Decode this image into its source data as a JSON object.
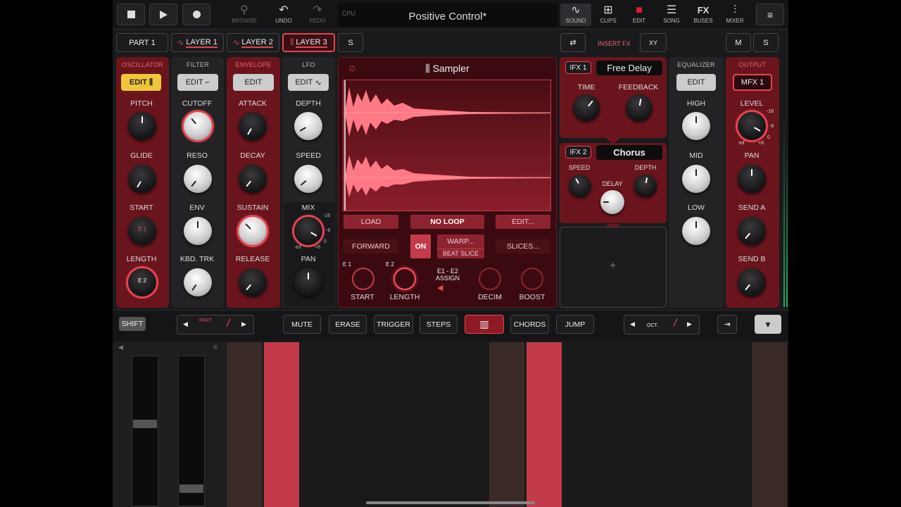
{
  "toolbar": {
    "browse": "BROWSE",
    "undo": "UNDO",
    "redo": "REDO",
    "cpu": "CPU",
    "title": "Positive Control*",
    "sound": "SOUND",
    "clips": "CLIPS",
    "edit": "EDIT",
    "song": "SONG",
    "fx": "FX",
    "buses": "BUSES",
    "mixer": "MIXER"
  },
  "parts": {
    "part": "PART",
    "part_num": "1",
    "layer1": "LAYER 1",
    "layer2": "LAYER 2",
    "layer3": "LAYER 3",
    "s": "S",
    "insert_fx": "INSERT FX",
    "xy": "XY",
    "m": "M",
    "s2": "S"
  },
  "osc": {
    "h": "OSCILLATOR",
    "edit": "EDIT",
    "pitch": "PITCH",
    "glide": "GLIDE",
    "start": "START",
    "length": "LENGTH",
    "e1": "E 1",
    "e2": "E 2"
  },
  "filter": {
    "h": "FILTER",
    "edit": "EDIT",
    "cutoff": "CUTOFF",
    "reso": "RESO",
    "env": "ENV",
    "kbd": "KBD. TRK"
  },
  "envelope": {
    "h": "ENVELOPE",
    "edit": "EDIT",
    "attack": "ATTACK",
    "decay": "DECAY",
    "sustain": "SUSTAIN",
    "release": "RELEASE"
  },
  "lfo": {
    "h": "LFO",
    "edit": "EDIT",
    "depth": "DEPTH",
    "speed": "SPEED",
    "mix": "MIX",
    "pan": "PAN",
    "m16": "-16",
    "m6": "-6",
    "m0": "0",
    "inf": "-inf",
    "p6": "+6"
  },
  "sampler": {
    "title": "Sampler",
    "load": "LOAD",
    "noloop": "NO LOOP",
    "edit": "EDIT...",
    "forward": "FORWARD",
    "on": "ON",
    "warp": "WARP...",
    "beatslice": "BEAT SLICE",
    "slices": "SLICES...",
    "e1": "E 1",
    "e2": "E 2",
    "start": "START",
    "length": "LENGTH",
    "assign1": "E1 - E2",
    "assign2": "ASSIGN",
    "decim": "DECIM",
    "boost": "BOOST"
  },
  "ifx1": {
    "tag": "IFX 1",
    "name": "Free Delay",
    "time": "TIME",
    "feedback": "FEEDBACK"
  },
  "ifx2": {
    "tag": "IFX 2",
    "name": "Chorus",
    "speed": "SPEED",
    "delay": "DELAY",
    "depth": "DEPTH"
  },
  "eq": {
    "h": "EQUALIZER",
    "edit": "EDIT",
    "high": "HIGH",
    "mid": "MID",
    "low": "LOW"
  },
  "out": {
    "h": "OUTPUT",
    "mfx": "MFX 1",
    "level": "LEVEL",
    "pan": "PAN",
    "senda": "SEND A",
    "sendb": "SEND B",
    "m16": "-16",
    "m6": "-6",
    "m0": "0",
    "inf": "-inf",
    "p6": "+6"
  },
  "bottom": {
    "shift": "SHIFT",
    "part": "PART",
    "mute": "MUTE",
    "erase": "ERASE",
    "trigger": "TRIGGER",
    "steps": "STEPS",
    "chords": "CHORDS",
    "jump": "JUMP",
    "oct": "OCT."
  }
}
